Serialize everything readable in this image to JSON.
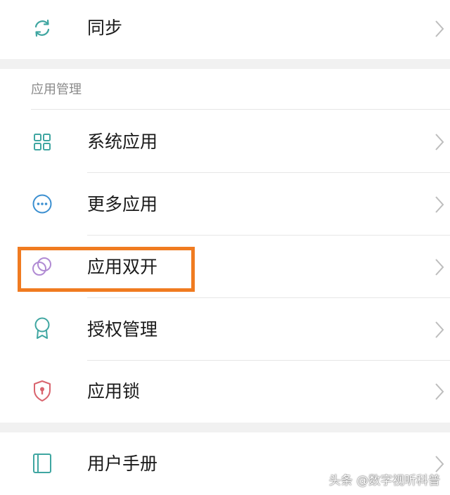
{
  "colors": {
    "teal_icon": "#3fa6a1",
    "blue_icon": "#3b8fd0",
    "purple_icon": "#b08ad3",
    "red_icon": "#d9646e",
    "chevron": "#bdbdbd",
    "highlight": "#f07b20",
    "section_bg": "#f1f1f1"
  },
  "top_row": {
    "icon": "sync-icon",
    "label": "同步"
  },
  "app_management": {
    "title": "应用管理",
    "items": [
      {
        "icon": "grid-icon",
        "label": "系统应用"
      },
      {
        "icon": "more-dots-icon",
        "label": "更多应用"
      },
      {
        "icon": "dual-circles-icon",
        "label": "应用双开"
      },
      {
        "icon": "award-icon",
        "label": "授权管理"
      },
      {
        "icon": "shield-lock-icon",
        "label": "应用锁"
      }
    ]
  },
  "bottom_row": {
    "icon": "manual-icon",
    "label": "用户手册"
  },
  "watermark": "头条 @数字视听科普"
}
